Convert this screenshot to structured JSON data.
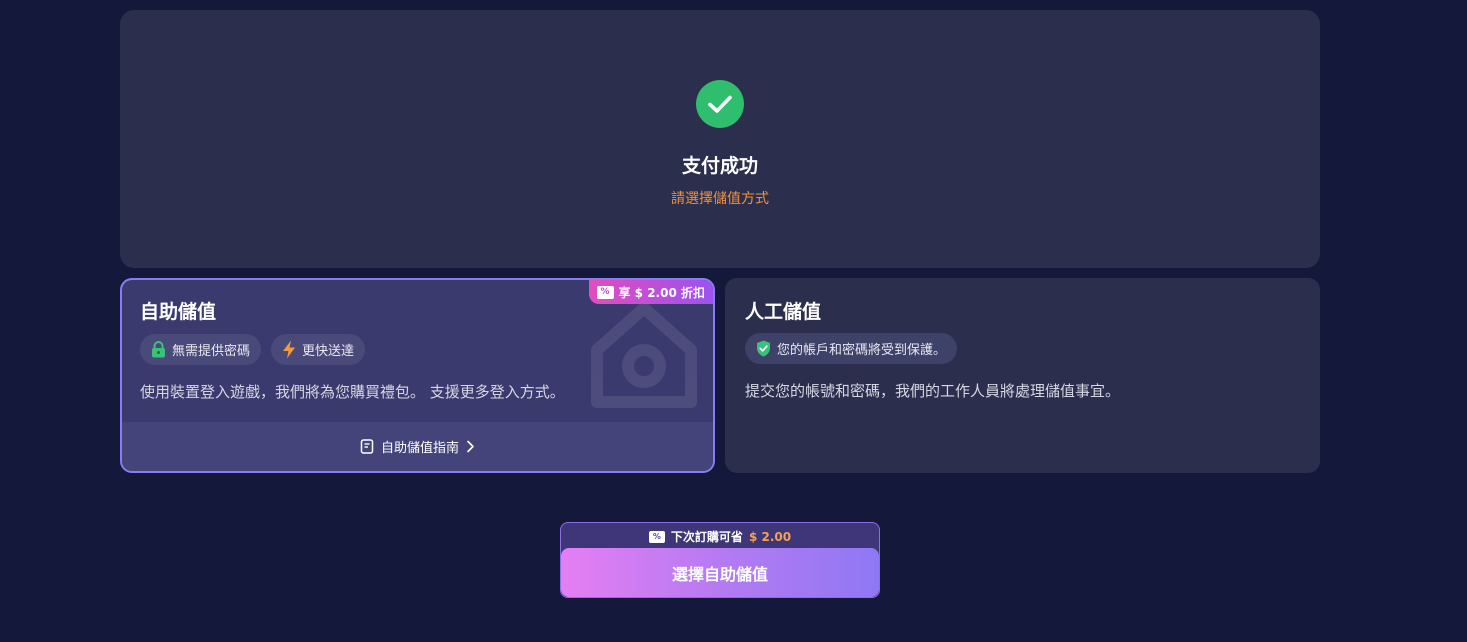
{
  "success": {
    "icon": "check-circle-icon",
    "title": "支付成功",
    "subtitle": "請選擇儲值方式",
    "icon_color": "#2fbe6e",
    "subtitle_color": "#f0913a"
  },
  "self_topup": {
    "title": "自助儲值",
    "selected": true,
    "discount_badge": {
      "icon": "percent-ticket-icon",
      "label": "享 $ 2.00 折扣"
    },
    "chips": [
      {
        "icon": "lock-icon",
        "label": "無需提供密碼"
      },
      {
        "icon": "lightning-icon",
        "label": "更快送達"
      }
    ],
    "description": "使用裝置登入遊戲，我們將為您購買禮包。 支援更多登入方式。",
    "guide": {
      "icon": "document-icon",
      "label": "自助儲值指南",
      "chevron": "chevron-right-icon"
    }
  },
  "manual_topup": {
    "title": "人工儲值",
    "selected": false,
    "chips": [
      {
        "icon": "shield-check-icon",
        "label": "您的帳戶和密碼將受到保護。"
      }
    ],
    "description": "提交您的帳號和密碼，我們的工作人員將處理儲值事宜。"
  },
  "action": {
    "note_icon": "percent-ticket-icon",
    "note_prefix": "下次訂購可省",
    "note_amount": "$ 2.00",
    "button_label": "選擇自助儲值"
  },
  "colors": {
    "background": "#14183a",
    "panel": "#2c2e4d",
    "accent_border": "#8a7cf5",
    "amount": "#f7a14a"
  }
}
